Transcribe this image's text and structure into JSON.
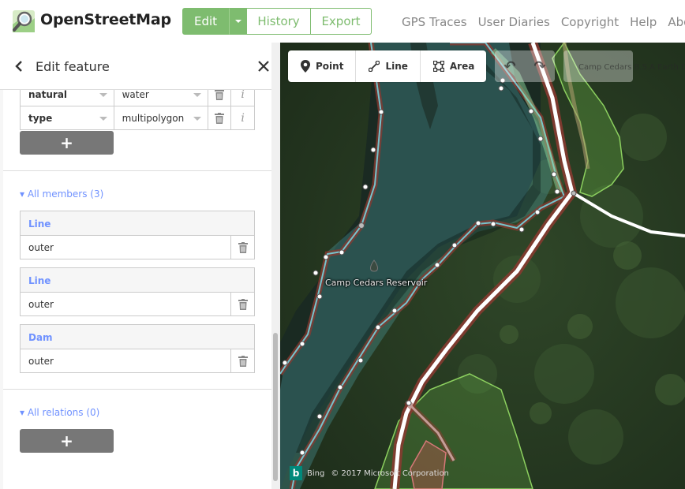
{
  "header": {
    "brand": "OpenStreetMap",
    "edit_label": "Edit",
    "history_label": "History",
    "export_label": "Export",
    "links": [
      "GPS Traces",
      "User Diaries",
      "Copyright",
      "Help",
      "Abou"
    ]
  },
  "sidebar": {
    "title": "Edit feature",
    "tags": [
      {
        "key": "natural",
        "value": "water"
      },
      {
        "key": "type",
        "value": "multipolygon"
      }
    ],
    "add_label": "+",
    "members_heading": "All members (3)",
    "members": [
      {
        "type": "Line",
        "role": "outer"
      },
      {
        "type": "Line",
        "role": "outer"
      },
      {
        "type": "Dam",
        "role": "outer"
      }
    ],
    "relations_heading": "All relations (0)"
  },
  "map": {
    "modes": [
      {
        "label": "Point",
        "icon": "point-icon"
      },
      {
        "label": "Line",
        "icon": "line-icon"
      },
      {
        "label": "Area",
        "icon": "area-icon"
      }
    ],
    "feature_label": "Camp Cedars Reservoir",
    "background_label": "Camp Cedars B.S.A Earth Dam",
    "attribution_provider": "Bing",
    "attribution_text": "© 2017 Microsoft Corporation",
    "colors": {
      "accent": "#7ebc6f",
      "link": "#7092ff",
      "water": "#77d3de",
      "road": "#ffffff",
      "dam": "#8cd05f"
    }
  }
}
